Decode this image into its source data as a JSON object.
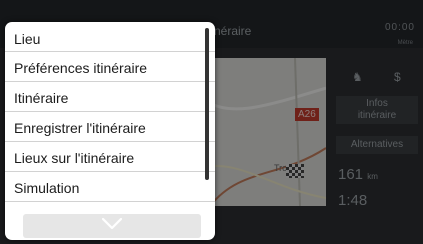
{
  "background": {
    "header_title": "néraire",
    "clock": "00:00",
    "subtitle": "Mètre",
    "road_label": "A26",
    "town_label": "Tro",
    "info_button": "Infos\nitinéraire",
    "alternatives_button": "Alternatives",
    "distance_value": "161",
    "distance_unit": "km",
    "time_value": "1:48"
  },
  "menu": {
    "items": [
      {
        "label": "Lieu"
      },
      {
        "label": "Préférences itinéraire"
      },
      {
        "label": "Itinéraire"
      },
      {
        "label": "Enregistrer l'itinéraire"
      },
      {
        "label": "Lieux sur l'itinéraire"
      },
      {
        "label": "Simulation"
      }
    ],
    "more_icon": "chevron-down-icon"
  }
}
